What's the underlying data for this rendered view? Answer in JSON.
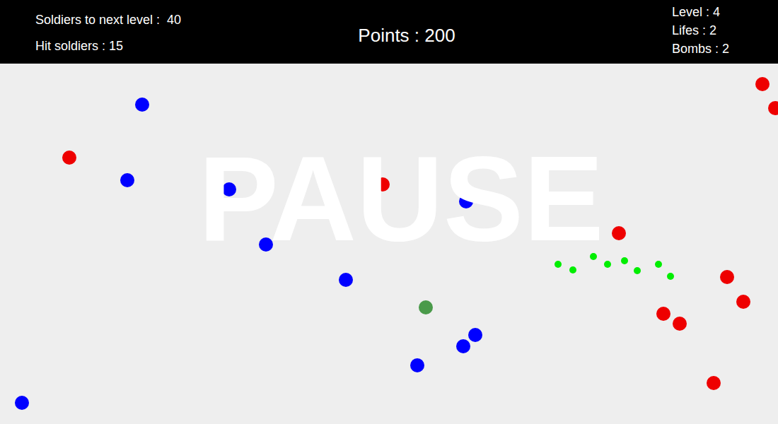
{
  "hud": {
    "left": [
      "Soldiers to next level :  40",
      "Hit soldiers : 15"
    ],
    "center": "Points : 200",
    "right": [
      "Level : 4",
      "Lifes : 2",
      "Bombs : 2"
    ]
  },
  "overlay": "PAUSE",
  "dots": [
    {
      "kind": "unit",
      "color": "#0000ff"
    },
    {
      "kind": "unit",
      "color": "#0000ff"
    },
    {
      "kind": "unit",
      "color": "#0000ff"
    },
    {
      "kind": "unit",
      "color": "#0000ff"
    },
    {
      "kind": "unit",
      "color": "#0000ff"
    },
    {
      "kind": "unit",
      "color": "#0000ff"
    },
    {
      "kind": "unit",
      "color": "#0000ff"
    },
    {
      "kind": "unit",
      "color": "#0000ff"
    },
    {
      "kind": "unit",
      "color": "#0000ff"
    },
    {
      "kind": "unit",
      "color": "#0000ff"
    },
    {
      "kind": "unit",
      "color": "#0000ff"
    },
    {
      "kind": "unit",
      "color": "#ee0000"
    },
    {
      "kind": "unit",
      "color": "#ee0000"
    },
    {
      "kind": "unit",
      "color": "#ee0000"
    },
    {
      "kind": "unit",
      "color": "#ee0000"
    },
    {
      "kind": "unit",
      "color": "#ee0000"
    },
    {
      "kind": "unit",
      "color": "#ee0000"
    },
    {
      "kind": "unit",
      "color": "#ee0000"
    },
    {
      "kind": "unit",
      "color": "#ee0000"
    },
    {
      "kind": "unit",
      "color": "#ee0000"
    },
    {
      "kind": "unit",
      "color": "#ee0000"
    },
    {
      "kind": "unit",
      "color": "#4a9a4a"
    },
    {
      "kind": "bullet",
      "color": "#00ee00"
    },
    {
      "kind": "bullet",
      "color": "#00ee00"
    },
    {
      "kind": "bullet",
      "color": "#00ee00"
    },
    {
      "kind": "bullet",
      "color": "#00ee00"
    },
    {
      "kind": "bullet",
      "color": "#00ee00"
    },
    {
      "kind": "bullet",
      "color": "#00ee00"
    },
    {
      "kind": "bullet",
      "color": "#00ee00"
    },
    {
      "kind": "bullet",
      "color": "#00ee00"
    }
  ]
}
